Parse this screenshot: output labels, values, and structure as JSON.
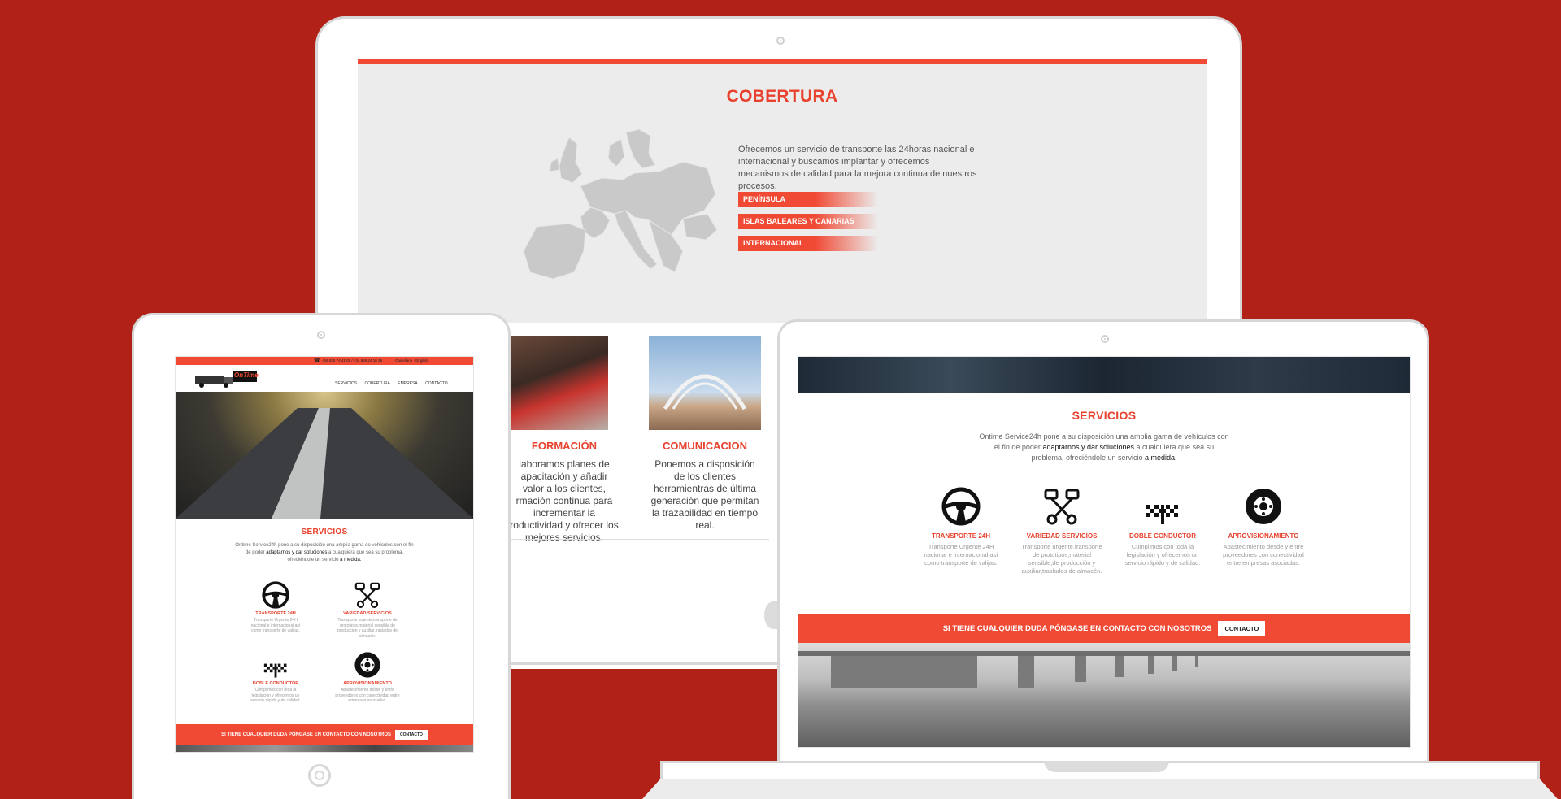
{
  "colors": {
    "background": "#b12118",
    "accent": "#f04a35",
    "accent_text": "#e8412d"
  },
  "monitor": {
    "heading": "COBERTURA",
    "description": "Ofrecemos un servicio de transporte las 24horas nacional e internacional y buscamos implantar y ofrecemos mecanismos de calidad para la mejora continua de nuestros procesos.",
    "regions": [
      "PENÍNSULA",
      "ISLAS BALEARES Y CANARIAS",
      "INTERNACIONAL"
    ],
    "cards": [
      {
        "title": "FORMACIÓN",
        "text": "laboramos planes de apacitación y añadir valor a los clientes, rmación continua para incrementar la roductividad y ofrecer los mejores servicios."
      },
      {
        "title": "COMUNICACION",
        "text": "Ponemos a disposición de los clientes herramientras de última generación que permitan la trazabilidad en tiempo real."
      }
    ]
  },
  "tablet": {
    "topbar": {
      "phone": "+34 635 74 41 09 / +34 626 24 10 25",
      "language": "Castellano · English"
    },
    "logo_text": "OnTime",
    "nav": [
      "SERVICIOS",
      "COBERTURA",
      "EMPRESA",
      "CONTACTO"
    ],
    "heading": "SERVICIOS",
    "intro": {
      "pre": "Ontime Service24h pone a su disposición una amplia gama de vehículos con el fin de poder ",
      "bold1": "adaptarnos y dar soluciones",
      "mid": " a cualquiera que sea su problema, ofreciéndole un servicio ",
      "bold2": "a medida."
    },
    "features": [
      {
        "icon": "steering-wheel-icon",
        "title": "TRANSPORTE 24H",
        "text": "Transporte Urgente 24H nacional e internacional así como transporte de valijas."
      },
      {
        "icon": "pistons-icon",
        "title": "VARIEDAD SERVICIOS",
        "text": "Transporte urgente,transporte de prototipos,material sensible,de producción y auxiliar,traslados de almacén."
      },
      {
        "icon": "checkered-flags-icon",
        "title": "DOBLE CONDUCTOR",
        "text": "Cumplimos con toda la legislación y ofrecemos un servicio rápido y de calidad."
      },
      {
        "icon": "tire-icon",
        "title": "APROVISIONAMIENTO",
        "text": "Abastecimiento desde y entre proveedores con conectividad entre empresas asociadas."
      }
    ],
    "cta": {
      "text": "SI TIENE CUALQUIER DUDA PÓNGASE EN CONTACTO CON NOSOTROS",
      "button": "CONTACTO"
    }
  },
  "laptop": {
    "heading": "SERVICIOS",
    "intro": {
      "pre": "Ontime Service24h pone a su disposición una amplia gama de vehículos con el fin de poder ",
      "bold1": "adaptarnos y dar soluciones",
      "mid": " a cualquiera que sea su problema, ofreciéndole un servicio ",
      "bold2": "a medida."
    },
    "features": [
      {
        "icon": "steering-wheel-icon",
        "title": "TRANSPORTE 24H",
        "text": "Transporte Urgente 24H nacional e internacional así como transporte de valijas."
      },
      {
        "icon": "pistons-icon",
        "title": "VARIEDAD SERVICIOS",
        "text": "Transporte urgente,transporte de prototipos,material sensible,de producción y auxiliar,traslados de almacén."
      },
      {
        "icon": "checkered-flags-icon",
        "title": "DOBLE CONDUCTOR",
        "text": "Cumplimos con toda la legislación y ofrecemos un servicio rápido y de calidad."
      },
      {
        "icon": "tire-icon",
        "title": "APROVISIONAMIENTO",
        "text": "Abastecimiento desde y entre proveedores con conectividad entre empresas asociadas."
      }
    ],
    "cta": {
      "text": "SI TIENE CUALQUIER DUDA PÓNGASE EN CONTACTO CON NOSOTROS",
      "button": "CONTACTO"
    }
  }
}
